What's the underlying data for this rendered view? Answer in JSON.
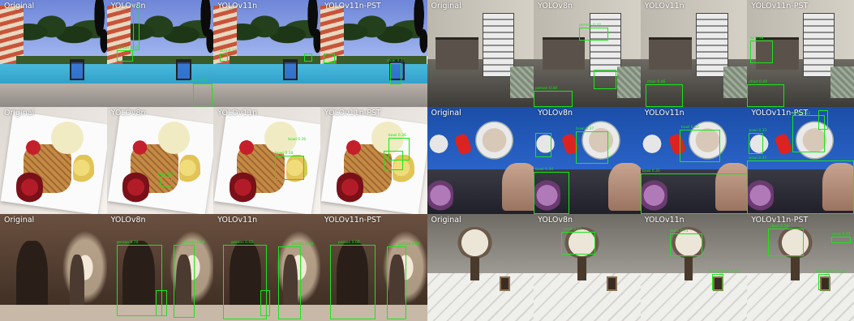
{
  "column_titles": [
    "Original",
    "YOLOv8n",
    "YOLOv11n",
    "YOLOv11n-PST"
  ],
  "detection_color": "#19e619",
  "label_color": "#ffffff",
  "detection_labels": {
    "A1": "bird 0.37",
    "A1b": "person 0.35",
    "A2": "chair 0.31",
    "B1": "person 0.32",
    "B1b": "person 0.44",
    "B2": "chair 0.46",
    "B3": "tv 0.38",
    "B3b": "chair 0.44",
    "C1": "bowl 0.28",
    "C2": "bowl 0.28",
    "C2b": "bowl 0.36",
    "D1": "bowl 0.37",
    "D1b": "bowl 0.34",
    "D2": "bowl 0.33",
    "D2b": "bowl 0.35",
    "D3": "bowl 0.32",
    "D3b": "bowl 0.33",
    "D4": "bowl 0.37",
    "E1": "person 0.70",
    "E1b": "person 0.38",
    "E2": "person 0.62",
    "E2b": "person 0.44",
    "E3": "person 0.66",
    "E3b": "person 0.48",
    "F1": "clock 0.63",
    "F2": "clock 0.71",
    "F2b": "fire hydrant 0.25",
    "F3": "clock 0.56",
    "F3b": "fire hydrant 0.25",
    "F3c": "clock 0.39"
  }
}
